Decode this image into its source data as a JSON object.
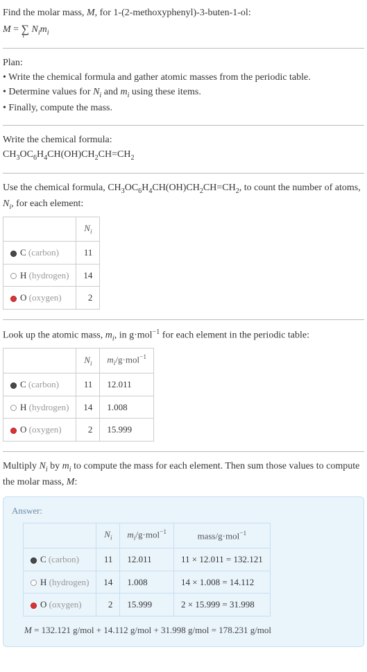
{
  "intro": {
    "line1_a": "Find the molar mass, ",
    "line1_b": ", for 1-(2-methoxyphenyl)-3-buten-1-ol:",
    "M": "M",
    "eq_lhs": "M",
    "eq_eq": " = ",
    "eq_sum": "∑",
    "eq_sum_sub": "i",
    "eq_rhs_a": " N",
    "eq_rhs_b": "m"
  },
  "plan": {
    "title": "Plan:",
    "b1": "• Write the chemical formula and gather atomic masses from the periodic table.",
    "b2_a": "• Determine values for ",
    "b2_b": " and ",
    "b2_c": " using these items.",
    "b3": "• Finally, compute the mass."
  },
  "step_formula": {
    "title": "Write the chemical formula:",
    "parts": [
      "CH",
      "3",
      "OC",
      "6",
      "H",
      "4",
      "CH(OH)CH",
      "2",
      "CH=CH",
      "2"
    ]
  },
  "step_count": {
    "t1": "Use the chemical formula, ",
    "t2": ", to count the number of atoms, ",
    "t3": ", for each element:",
    "header_n": "N",
    "rows": [
      {
        "dot": "dot-c",
        "sym": "C",
        "name": " (carbon)",
        "n": "11"
      },
      {
        "dot": "dot-h",
        "sym": "H",
        "name": " (hydrogen)",
        "n": "14"
      },
      {
        "dot": "dot-o",
        "sym": "O",
        "name": " (oxygen)",
        "n": "2"
      }
    ]
  },
  "step_mass": {
    "t1": "Look up the atomic mass, ",
    "t2": ", in g·mol",
    "t3": " for each element in the periodic table:",
    "exp_neg1": "−1",
    "header_m_a": "m",
    "header_m_b": "/g·mol",
    "rows": [
      {
        "dot": "dot-c",
        "sym": "C",
        "name": " (carbon)",
        "n": "11",
        "m": "12.011"
      },
      {
        "dot": "dot-h",
        "sym": "H",
        "name": " (hydrogen)",
        "n": "14",
        "m": "1.008"
      },
      {
        "dot": "dot-o",
        "sym": "O",
        "name": " (oxygen)",
        "n": "2",
        "m": "15.999"
      }
    ]
  },
  "step_mult": {
    "t1": "Multiply ",
    "t2": " by ",
    "t3": " to compute the mass for each element. Then sum those values to compute the molar mass, ",
    "t4": ":"
  },
  "answer": {
    "label": "Answer:",
    "header_mass_a": "mass/g·mol",
    "rows": [
      {
        "dot": "dot-c",
        "sym": "C",
        "name": " (carbon)",
        "n": "11",
        "m": "12.011",
        "calc": "11 × 12.011 = 132.121"
      },
      {
        "dot": "dot-h",
        "sym": "H",
        "name": " (hydrogen)",
        "n": "14",
        "m": "1.008",
        "calc": "14 × 1.008 = 14.112"
      },
      {
        "dot": "dot-o",
        "sym": "O",
        "name": " (oxygen)",
        "n": "2",
        "m": "15.999",
        "calc": "2 × 15.999 = 31.998"
      }
    ],
    "final_a": "M",
    "final_b": " = 132.121 g/mol + 14.112 g/mol + 31.998 g/mol = 178.231 g/mol"
  },
  "sym": {
    "Ni_a": "N",
    "Ni_b": "i",
    "mi_a": "m",
    "mi_b": "i"
  }
}
